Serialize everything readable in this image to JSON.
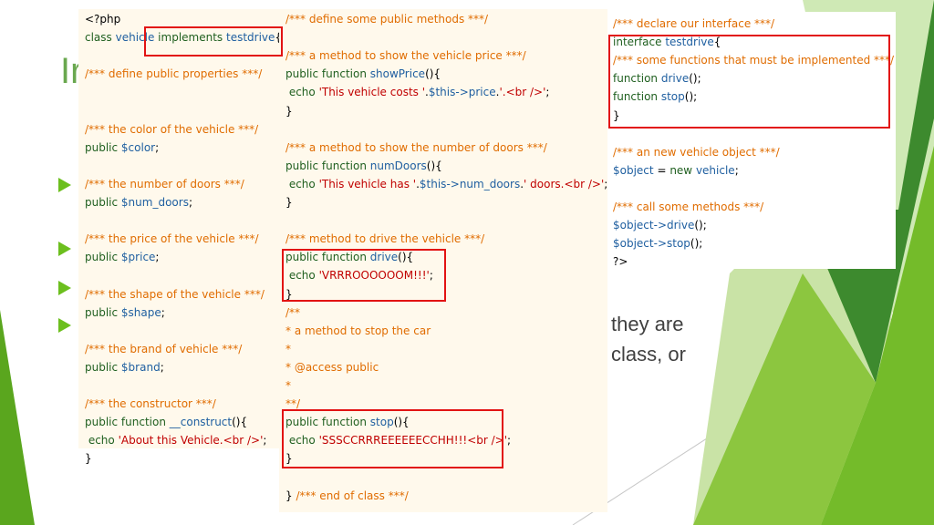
{
  "slide": {
    "title": "Ir",
    "bg_colors": {
      "green_dark": "#3d7f2a",
      "green_mid": "#6cbf1e",
      "green_light": "#b6d98b"
    },
    "body_text_lines": [
      "they  are",
      "class,  or"
    ]
  },
  "panel1": {
    "lines": [
      {
        "parts": [
          {
            "t": "<?php",
            "c": "plain"
          }
        ]
      },
      {
        "parts": [
          {
            "t": "class ",
            "c": "kw"
          },
          {
            "t": "vehicle ",
            "c": "name"
          },
          {
            "t": "implements ",
            "c": "kw"
          },
          {
            "t": "testdrive",
            "c": "name"
          },
          {
            "t": "{",
            "c": "plain"
          }
        ]
      },
      {
        "parts": [
          {
            "t": "",
            "c": "plain"
          }
        ]
      },
      {
        "parts": [
          {
            "t": "/*** define public properties ***/",
            "c": "comment"
          }
        ]
      },
      {
        "parts": [
          {
            "t": "",
            "c": "plain"
          }
        ]
      },
      {
        "parts": [
          {
            "t": "",
            "c": "plain"
          }
        ]
      },
      {
        "parts": [
          {
            "t": "/*** the color of the vehicle ***/",
            "c": "comment"
          }
        ]
      },
      {
        "parts": [
          {
            "t": "public ",
            "c": "kw"
          },
          {
            "t": "$color",
            "c": "name"
          },
          {
            "t": ";",
            "c": "plain"
          }
        ]
      },
      {
        "parts": [
          {
            "t": "",
            "c": "plain"
          }
        ]
      },
      {
        "parts": [
          {
            "t": "/*** the number of doors ***/",
            "c": "comment"
          }
        ]
      },
      {
        "parts": [
          {
            "t": "public ",
            "c": "kw"
          },
          {
            "t": "$num_doors",
            "c": "name"
          },
          {
            "t": ";",
            "c": "plain"
          }
        ]
      },
      {
        "parts": [
          {
            "t": "",
            "c": "plain"
          }
        ]
      },
      {
        "parts": [
          {
            "t": "/*** the price of the vehicle ***/",
            "c": "comment"
          }
        ]
      },
      {
        "parts": [
          {
            "t": "public ",
            "c": "kw"
          },
          {
            "t": "$price",
            "c": "name"
          },
          {
            "t": ";",
            "c": "plain"
          }
        ]
      },
      {
        "parts": [
          {
            "t": "",
            "c": "plain"
          }
        ]
      },
      {
        "parts": [
          {
            "t": "/*** the shape of the vehicle ***/",
            "c": "comment"
          }
        ]
      },
      {
        "parts": [
          {
            "t": "public ",
            "c": "kw"
          },
          {
            "t": "$shape",
            "c": "name"
          },
          {
            "t": ";",
            "c": "plain"
          }
        ]
      },
      {
        "parts": [
          {
            "t": "",
            "c": "plain"
          }
        ]
      },
      {
        "parts": [
          {
            "t": "/*** the brand of vehicle ***/",
            "c": "comment"
          }
        ]
      },
      {
        "parts": [
          {
            "t": "public ",
            "c": "kw"
          },
          {
            "t": "$brand",
            "c": "name"
          },
          {
            "t": ";",
            "c": "plain"
          }
        ]
      },
      {
        "parts": [
          {
            "t": "",
            "c": "plain"
          }
        ]
      },
      {
        "parts": [
          {
            "t": "/*** the constructor ***/",
            "c": "comment"
          }
        ]
      },
      {
        "parts": [
          {
            "t": "public function ",
            "c": "kw"
          },
          {
            "t": "__construct",
            "c": "name"
          },
          {
            "t": "(){",
            "c": "plain"
          }
        ]
      },
      {
        "parts": [
          {
            "t": " echo ",
            "c": "kw"
          },
          {
            "t": "'About this Vehicle.<br />'",
            "c": "str"
          },
          {
            "t": ";",
            "c": "plain"
          }
        ]
      },
      {
        "parts": [
          {
            "t": "}",
            "c": "plain"
          }
        ]
      }
    ]
  },
  "panel2": {
    "lines": [
      {
        "parts": [
          {
            "t": "/*** define some public methods ***/",
            "c": "comment"
          }
        ]
      },
      {
        "parts": [
          {
            "t": "",
            "c": "plain"
          }
        ]
      },
      {
        "parts": [
          {
            "t": "/*** a method to show the vehicle price ***/",
            "c": "comment"
          }
        ]
      },
      {
        "parts": [
          {
            "t": "public function ",
            "c": "kw"
          },
          {
            "t": "showPrice",
            "c": "name"
          },
          {
            "t": "(){",
            "c": "plain"
          }
        ]
      },
      {
        "parts": [
          {
            "t": " echo ",
            "c": "kw"
          },
          {
            "t": "'This vehicle costs '",
            "c": "str"
          },
          {
            "t": ".",
            "c": "plain"
          },
          {
            "t": "$this->price",
            "c": "name"
          },
          {
            "t": ".",
            "c": "plain"
          },
          {
            "t": "'.<br />'",
            "c": "str"
          },
          {
            "t": ";",
            "c": "plain"
          }
        ]
      },
      {
        "parts": [
          {
            "t": "}",
            "c": "plain"
          }
        ]
      },
      {
        "parts": [
          {
            "t": "",
            "c": "plain"
          }
        ]
      },
      {
        "parts": [
          {
            "t": "/*** a method to show the number of doors ***/",
            "c": "comment"
          }
        ]
      },
      {
        "parts": [
          {
            "t": "public function ",
            "c": "kw"
          },
          {
            "t": "numDoors",
            "c": "name"
          },
          {
            "t": "(){",
            "c": "plain"
          }
        ]
      },
      {
        "parts": [
          {
            "t": " echo ",
            "c": "kw"
          },
          {
            "t": "'This vehicle has '",
            "c": "str"
          },
          {
            "t": ".",
            "c": "plain"
          },
          {
            "t": "$this->num_doors",
            "c": "name"
          },
          {
            "t": ".",
            "c": "plain"
          },
          {
            "t": "' doors.<br />'",
            "c": "str"
          },
          {
            "t": ";",
            "c": "plain"
          }
        ]
      },
      {
        "parts": [
          {
            "t": "}",
            "c": "plain"
          }
        ]
      },
      {
        "parts": [
          {
            "t": "",
            "c": "plain"
          }
        ]
      },
      {
        "parts": [
          {
            "t": "/*** method to drive the vehicle ***/",
            "c": "comment"
          }
        ]
      },
      {
        "parts": [
          {
            "t": "public function ",
            "c": "kw"
          },
          {
            "t": "drive",
            "c": "name"
          },
          {
            "t": "(){",
            "c": "plain"
          }
        ]
      },
      {
        "parts": [
          {
            "t": " echo ",
            "c": "kw"
          },
          {
            "t": "'VRRROOOOOOM!!!'",
            "c": "str"
          },
          {
            "t": ";",
            "c": "plain"
          }
        ]
      },
      {
        "parts": [
          {
            "t": "}",
            "c": "plain"
          }
        ]
      },
      {
        "parts": [
          {
            "t": "/**",
            "c": "comment"
          }
        ]
      },
      {
        "parts": [
          {
            "t": "* a method to stop the car",
            "c": "comment"
          }
        ]
      },
      {
        "parts": [
          {
            "t": "*",
            "c": "comment"
          }
        ]
      },
      {
        "parts": [
          {
            "t": "* @access public",
            "c": "comment"
          }
        ]
      },
      {
        "parts": [
          {
            "t": "*",
            "c": "comment"
          }
        ]
      },
      {
        "parts": [
          {
            "t": "**/",
            "c": "comment"
          }
        ]
      },
      {
        "parts": [
          {
            "t": "public function ",
            "c": "kw"
          },
          {
            "t": "stop",
            "c": "name"
          },
          {
            "t": "(){",
            "c": "plain"
          }
        ]
      },
      {
        "parts": [
          {
            "t": " echo ",
            "c": "kw"
          },
          {
            "t": "'SSSCCRRREEEEEECCHH!!!<br />'",
            "c": "str"
          },
          {
            "t": ";",
            "c": "plain"
          }
        ]
      },
      {
        "parts": [
          {
            "t": "}",
            "c": "plain"
          }
        ]
      },
      {
        "parts": [
          {
            "t": "",
            "c": "plain"
          }
        ]
      },
      {
        "parts": [
          {
            "t": "} ",
            "c": "plain"
          },
          {
            "t": "/*** end of class ***/",
            "c": "comment"
          }
        ]
      }
    ]
  },
  "panel3": {
    "lines": [
      {
        "parts": [
          {
            "t": "/*** declare our interface ***/",
            "c": "comment"
          }
        ]
      },
      {
        "parts": [
          {
            "t": "interface ",
            "c": "kw"
          },
          {
            "t": "testdrive",
            "c": "name"
          },
          {
            "t": "{",
            "c": "plain"
          }
        ]
      },
      {
        "parts": [
          {
            "t": "/*** some functions that must be implemented ***/",
            "c": "comment"
          }
        ]
      },
      {
        "parts": [
          {
            "t": "function ",
            "c": "kw"
          },
          {
            "t": "drive",
            "c": "name"
          },
          {
            "t": "();",
            "c": "plain"
          }
        ]
      },
      {
        "parts": [
          {
            "t": "function ",
            "c": "kw"
          },
          {
            "t": "stop",
            "c": "name"
          },
          {
            "t": "();",
            "c": "plain"
          }
        ]
      },
      {
        "parts": [
          {
            "t": "}",
            "c": "plain"
          }
        ]
      },
      {
        "parts": [
          {
            "t": "",
            "c": "plain"
          }
        ]
      },
      {
        "parts": [
          {
            "t": "/*** an new vehicle object ***/",
            "c": "comment"
          }
        ]
      },
      {
        "parts": [
          {
            "t": "$object",
            "c": "name"
          },
          {
            "t": " = ",
            "c": "plain"
          },
          {
            "t": "new ",
            "c": "kw"
          },
          {
            "t": "vehicle",
            "c": "name"
          },
          {
            "t": ";",
            "c": "plain"
          }
        ]
      },
      {
        "parts": [
          {
            "t": "",
            "c": "plain"
          }
        ]
      },
      {
        "parts": [
          {
            "t": "/*** call some methods ***/",
            "c": "comment"
          }
        ]
      },
      {
        "parts": [
          {
            "t": "$object->drive",
            "c": "name"
          },
          {
            "t": "();",
            "c": "plain"
          }
        ]
      },
      {
        "parts": [
          {
            "t": "$object->stop",
            "c": "name"
          },
          {
            "t": "();",
            "c": "plain"
          }
        ]
      },
      {
        "parts": [
          {
            "t": "?>",
            "c": "plain"
          }
        ]
      }
    ]
  }
}
